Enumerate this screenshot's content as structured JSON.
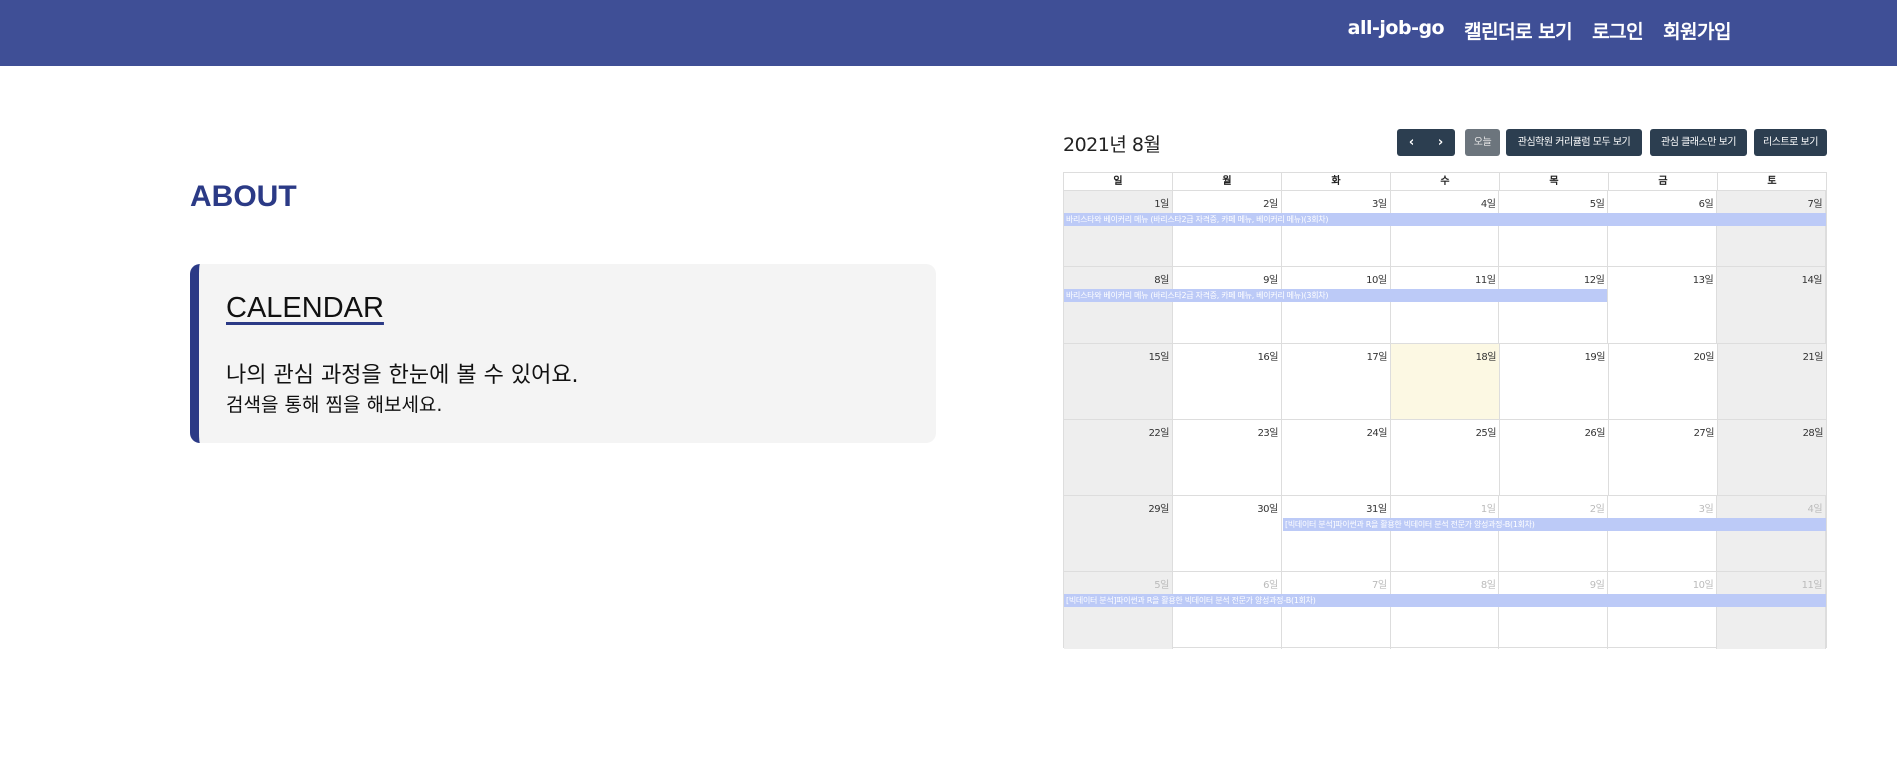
{
  "nav": {
    "brand": "all-job-go",
    "calendar": "캘린더로 보기",
    "login": "로그인",
    "signup": "회원가입"
  },
  "about": {
    "title": "ABOUT",
    "card_title": "CALENDAR",
    "line1": "나의 관심 과정을 한눈에 볼 수 있어요.",
    "line2": "검색을 통해 찜을 해보세요."
  },
  "calendar": {
    "title": "2021년 8월",
    "prev_icon": "chevron-left-icon",
    "next_icon": "chevron-right-icon",
    "today_label": "오늘",
    "btn_all": "관심학원 커리큘럼 모두 보기",
    "btn_class": "관심 클래스만 보기",
    "btn_list": "리스트로 보기",
    "weekdays": [
      "일",
      "월",
      "화",
      "수",
      "목",
      "금",
      "토"
    ],
    "weeks": [
      [
        "1일",
        "2일",
        "3일",
        "4일",
        "5일",
        "6일",
        "7일"
      ],
      [
        "8일",
        "9일",
        "10일",
        "11일",
        "12일",
        "13일",
        "14일"
      ],
      [
        "15일",
        "16일",
        "17일",
        "18일",
        "19일",
        "20일",
        "21일"
      ],
      [
        "22일",
        "23일",
        "24일",
        "25일",
        "26일",
        "27일",
        "28일"
      ],
      [
        "29일",
        "30일",
        "31일",
        "1일",
        "2일",
        "3일",
        "4일"
      ],
      [
        "5일",
        "6일",
        "7일",
        "8일",
        "9일",
        "10일",
        "11일"
      ]
    ],
    "events": [
      "바리스타와 베이커리 메뉴 (바리스타2급 자격증, 카페 메뉴, 베이커리 메뉴)(3회차)",
      "바리스타와 베이커리 메뉴 (바리스타2급 자격증, 카페 메뉴, 베이커리 메뉴)(3회차)",
      "[빅데이터 분석]파이썬과 R을 활용한 빅데이터 분석 전문가 양성과정-B(1회차)",
      "[빅데이터 분석]파이썬과 R을 활용한 빅데이터 분석 전문가 양성과정-B(1회차)"
    ]
  },
  "colors": {
    "header_bg": "#3f4f96",
    "accent": "#2b3a86",
    "event_bg": "#bccaf7",
    "today_bg": "#fcf8e3",
    "button_bg": "#2c3e50"
  }
}
